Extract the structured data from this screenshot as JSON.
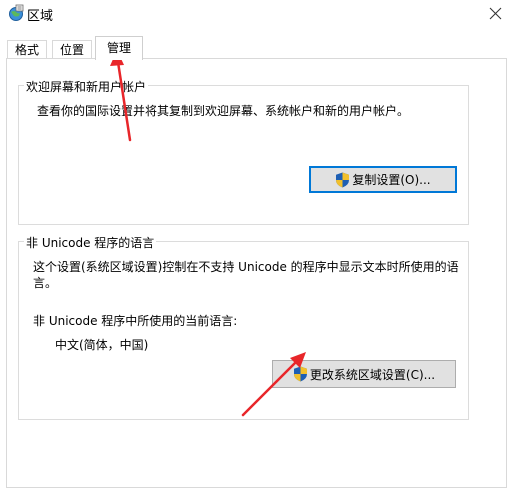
{
  "window": {
    "title": "区域",
    "icon": "region-globe-icon",
    "close_icon": "close-icon"
  },
  "tabs": [
    {
      "label": "格式",
      "active": false
    },
    {
      "label": "位置",
      "active": false
    },
    {
      "label": "管理",
      "active": true
    }
  ],
  "welcome_group": {
    "title": "欢迎屏幕和新用户帐户",
    "description": "查看你的国际设置并将其复制到欢迎屏幕、系统帐户和新的用户帐户。",
    "button_label": "复制设置(O)...",
    "button_icon": "uac-shield-icon"
  },
  "unicode_group": {
    "title": "非 Unicode 程序的语言",
    "description": "这个设置(系统区域设置)控制在不支持 Unicode 的程序中显示文本时所使用的语言。",
    "current_label": "非 Unicode 程序中所使用的当前语言:",
    "current_value": "中文(简体，中国)",
    "button_label": "更改系统区域设置(C)...",
    "button_icon": "uac-shield-icon"
  },
  "colors": {
    "focus_border": "#0078d7",
    "arrow": "#e8262a",
    "button_bg": "#e1e1e1"
  }
}
